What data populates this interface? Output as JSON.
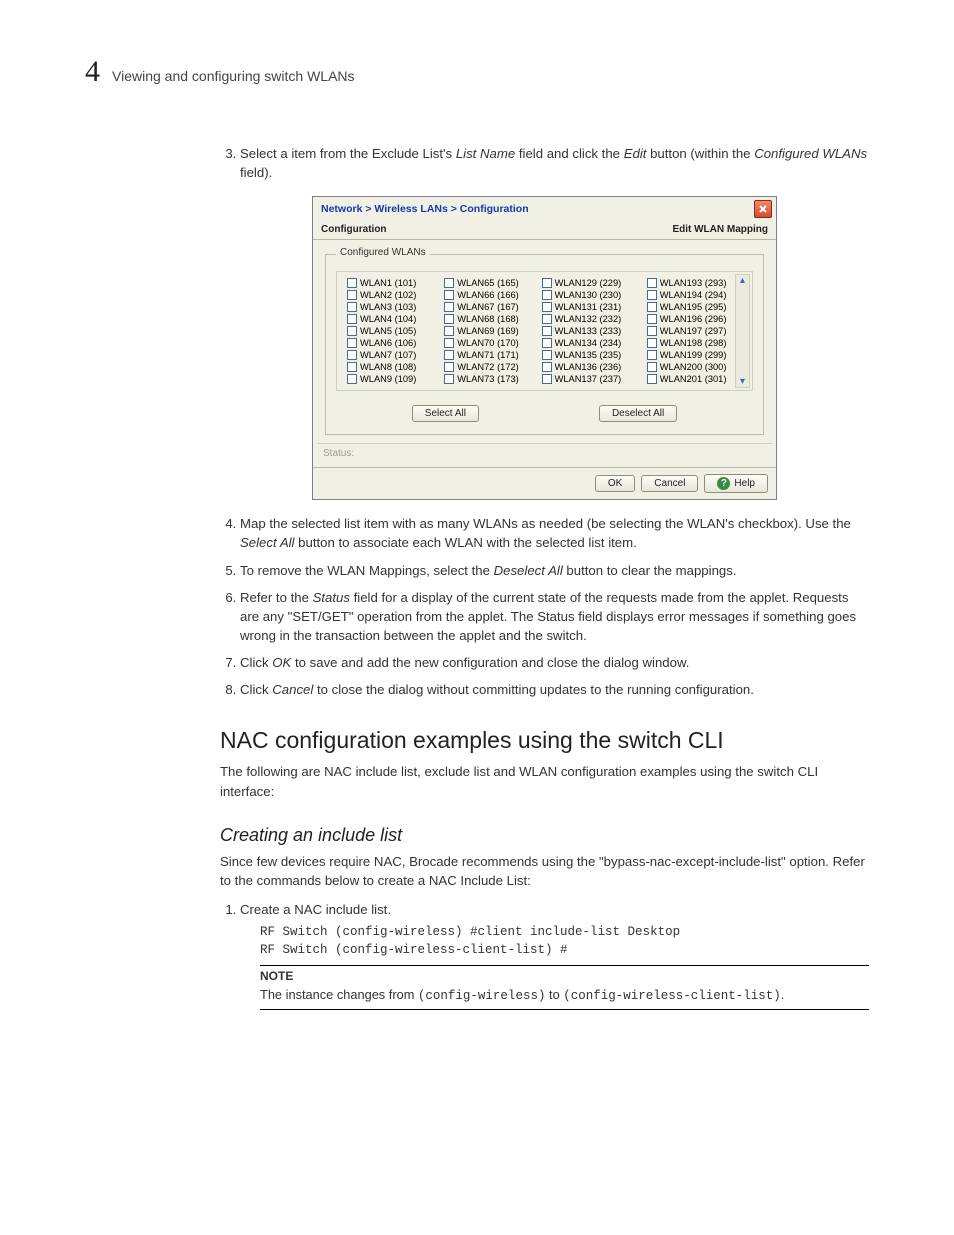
{
  "header": {
    "chapter_num": "4",
    "running_title": "Viewing and configuring switch WLANs"
  },
  "steps_a": {
    "start": 3,
    "item3_a": "Select a item from the Exclude List's ",
    "item3_i1": "List Name",
    "item3_b": " field and click the ",
    "item3_i2": "Edit",
    "item3_c": " button (within the ",
    "item3_i3": "Configured WLANs",
    "item3_d": " field)."
  },
  "dialog": {
    "breadcrumb": "Network > Wireless LANs > Configuration",
    "sub_left": "Configuration",
    "sub_right": "Edit WLAN Mapping",
    "legend": "Configured WLANs",
    "columns": [
      [
        "WLAN1 (101)",
        "WLAN2 (102)",
        "WLAN3 (103)",
        "WLAN4 (104)",
        "WLAN5 (105)",
        "WLAN6 (106)",
        "WLAN7 (107)",
        "WLAN8 (108)",
        "WLAN9 (109)"
      ],
      [
        "WLAN65 (165)",
        "WLAN66 (166)",
        "WLAN67 (167)",
        "WLAN68 (168)",
        "WLAN69 (169)",
        "WLAN70 (170)",
        "WLAN71 (171)",
        "WLAN72 (172)",
        "WLAN73 (173)"
      ],
      [
        "WLAN129 (229)",
        "WLAN130 (230)",
        "WLAN131 (231)",
        "WLAN132 (232)",
        "WLAN133 (233)",
        "WLAN134 (234)",
        "WLAN135 (235)",
        "WLAN136 (236)",
        "WLAN137 (237)"
      ],
      [
        "WLAN193 (293)",
        "WLAN194 (294)",
        "WLAN195 (295)",
        "WLAN196 (296)",
        "WLAN197 (297)",
        "WLAN198 (298)",
        "WLAN199 (299)",
        "WLAN200 (300)",
        "WLAN201 (301)"
      ]
    ],
    "select_all": "Select All",
    "deselect_all": "Deselect All",
    "status_label": "Status:",
    "ok": "OK",
    "cancel": "Cancel",
    "help": "Help"
  },
  "steps_b": {
    "item4_a": "Map the selected list item with as many WLANs as needed (be selecting the WLAN's checkbox). Use the ",
    "item4_i1": "Select All",
    "item4_b": " button to associate each WLAN with the selected list item.",
    "item5_a": "To remove the WLAN Mappings, select the ",
    "item5_i1": "Deselect All",
    "item5_b": " button to clear the mappings.",
    "item6_a": "Refer to the ",
    "item6_i1": "Status",
    "item6_b": " field for a display of the current state of the requests made from the applet. Requests are any \"SET/GET\" operation from the applet. The Status field displays error messages if something goes wrong in the transaction between the applet and the switch.",
    "item7_a": "Click ",
    "item7_i1": "OK",
    "item7_b": " to save and add the new configuration and close the dialog window.",
    "item8_a": "Click ",
    "item8_i1": "Cancel",
    "item8_b": " to close the dialog without committing updates to the running configuration."
  },
  "section_title": "NAC configuration examples using the switch CLI",
  "section_intro": "The following are NAC include list, exclude list and WLAN configuration examples using the switch CLI interface:",
  "subsection_title": "Creating an include list",
  "sub_intro": "Since few devices require NAC, Brocade recommends using the \"bypass-nac-except-include-list\" option. Refer to the commands below to create a NAC Include List:",
  "cli_step1": "Create a NAC include list.",
  "cli_block": "RF Switch (config-wireless) #client include-list Desktop\nRF Switch (config-wireless-client-list) #",
  "note_title": "NOTE",
  "note_a": "The instance changes from ",
  "note_code1": "(config-wireless)",
  "note_b": " to ",
  "note_code2": "(config-wireless-client-list)",
  "note_c": "."
}
